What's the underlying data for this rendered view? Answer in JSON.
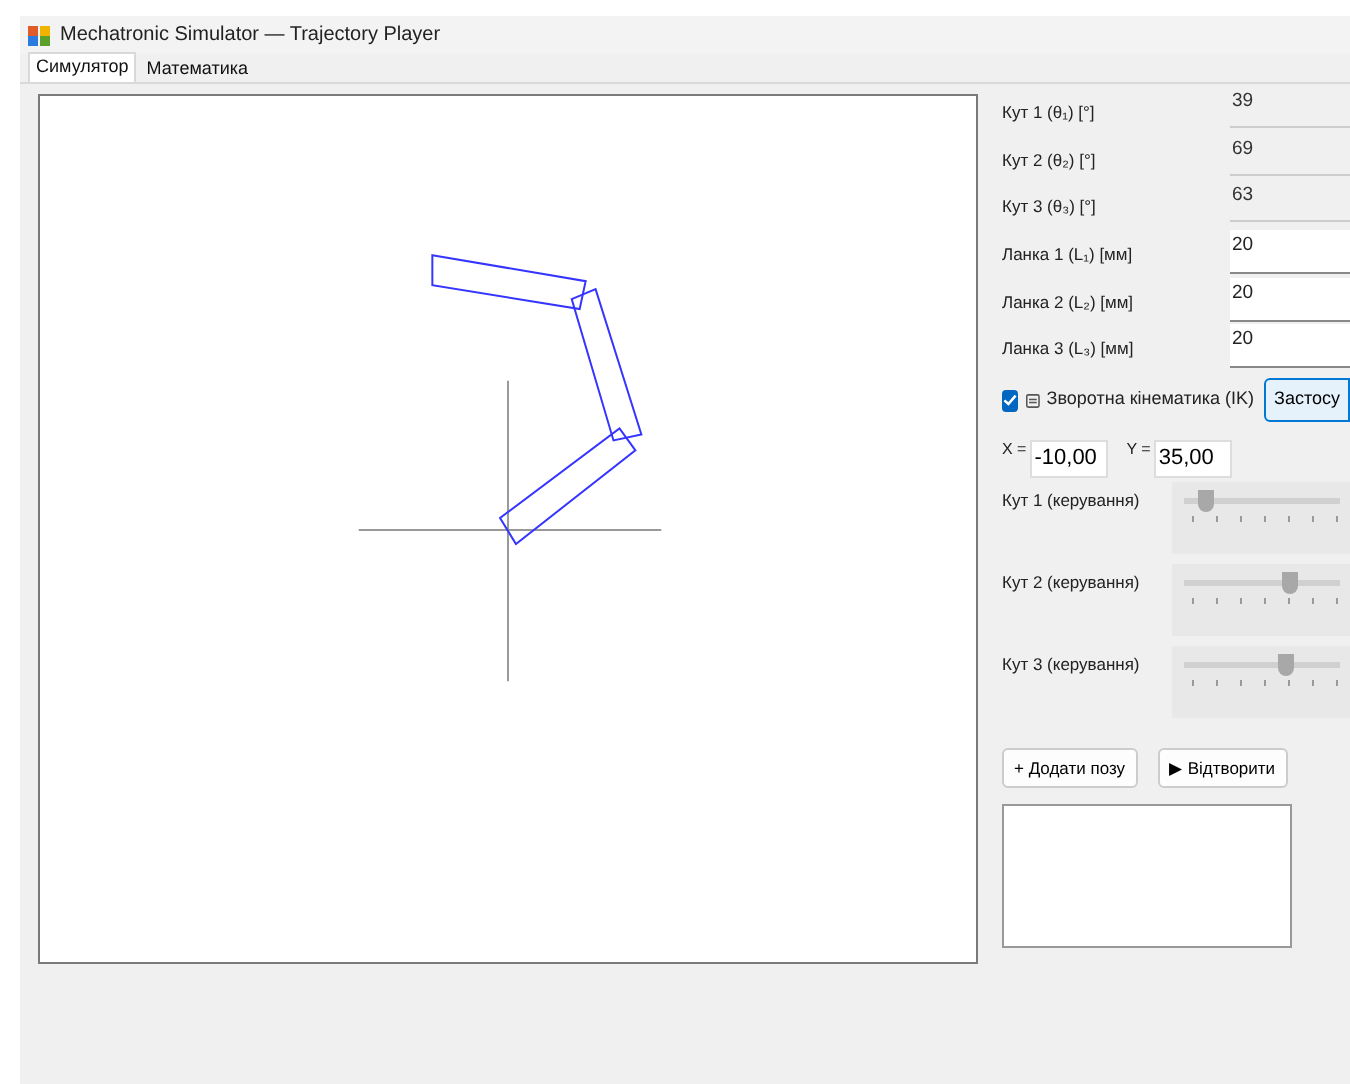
{
  "window": {
    "title": "Mechatronic Simulator — Trajectory Player"
  },
  "tabs": [
    {
      "label": "Симулятор",
      "selected": true
    },
    {
      "label": "Математика",
      "selected": false
    }
  ],
  "params": [
    {
      "label": "Кут 1 (θ₁) [°]",
      "value": "39",
      "disabled": true
    },
    {
      "label": "Кут 2 (θ₂) [°]",
      "value": "69",
      "disabled": true
    },
    {
      "label": "Кут 3 (θ₃) [°]",
      "value": "63",
      "disabled": true
    },
    {
      "label": "Ланка 1 (L₁) [мм]",
      "value": "20",
      "disabled": false
    },
    {
      "label": "Ланка 2 (L₂) [мм]",
      "value": "20",
      "disabled": false
    },
    {
      "label": "Ланка 3 (L₃) [мм]",
      "value": "20",
      "disabled": false
    }
  ],
  "ik": {
    "label": "Зворотна кінематика (IK)",
    "checked": true
  },
  "apply_button": "Застосу",
  "target": {
    "x_label": "X =",
    "x_value": "-10,00",
    "y_label": "Y =",
    "y_value": "35,00"
  },
  "sliders": [
    {
      "label": "Кут 1 (керування)",
      "level": 0.1
    },
    {
      "label": "Кут 2 (керування)",
      "level": 0.7
    },
    {
      "label": "Кут 3 (керування)",
      "level": 0.67
    }
  ],
  "buttons": [
    {
      "label": "+ Додати позу"
    },
    {
      "label": "▶ Відтворити"
    }
  ]
}
